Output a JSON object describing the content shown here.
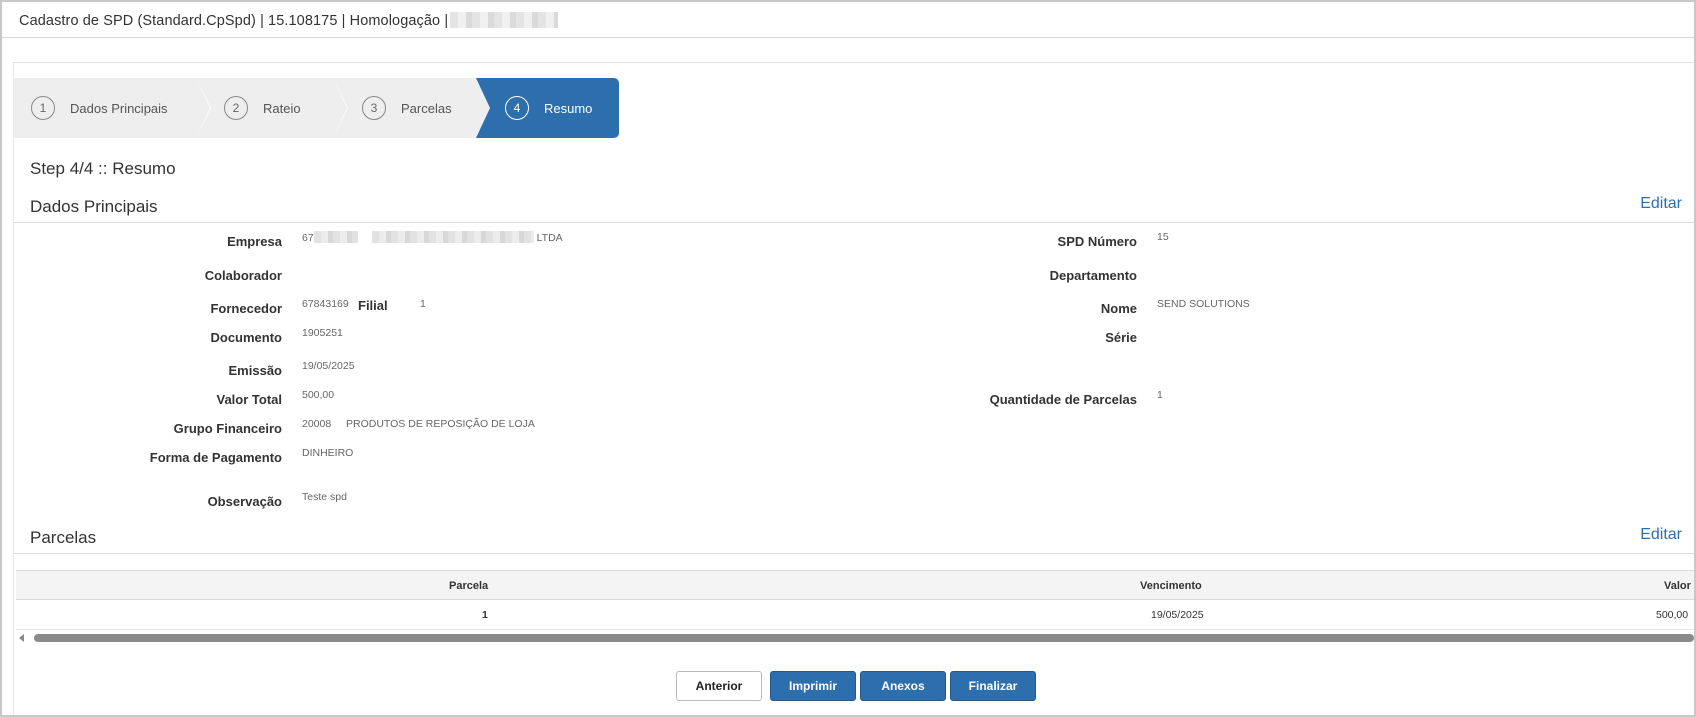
{
  "window": {
    "title": "Cadastro de SPD (Standard.CpSpd) | 15.108175 | Homologação |"
  },
  "wizard": {
    "steps": [
      {
        "num": "1",
        "label": "Dados Principais"
      },
      {
        "num": "2",
        "label": "Rateio"
      },
      {
        "num": "3",
        "label": "Parcelas"
      },
      {
        "num": "4",
        "label": "Resumo"
      }
    ],
    "active_step": 4
  },
  "step_title": "Step 4/4 :: Resumo",
  "dados_principais": {
    "section_title": "Dados Principais",
    "edit_label": "Editar",
    "empresa": {
      "label": "Empresa",
      "value_prefix": "67",
      "value_suffix": "LTDA"
    },
    "spd_numero": {
      "label": "SPD Número",
      "value": "15"
    },
    "colaborador": {
      "label": "Colaborador",
      "value": ""
    },
    "departamento": {
      "label": "Departamento",
      "value": ""
    },
    "fornecedor": {
      "label": "Fornecedor",
      "value": "67843169",
      "filial_label": "Filial",
      "filial_value": "1"
    },
    "nome": {
      "label": "Nome",
      "value": "SEND SOLUTIONS"
    },
    "documento": {
      "label": "Documento",
      "value": "1905251"
    },
    "serie": {
      "label": "Série",
      "value": ""
    },
    "emissao": {
      "label": "Emissão",
      "value": "19/05/2025"
    },
    "valor_total": {
      "label": "Valor Total",
      "value": "500,00"
    },
    "quantidade_parcelas": {
      "label": "Quantidade de Parcelas",
      "value": "1"
    },
    "grupo_financeiro": {
      "label": "Grupo Financeiro",
      "code": "20008",
      "value": "PRODUTOS DE REPOSIÇÃO DE LOJA"
    },
    "forma_pagamento": {
      "label": "Forma de Pagamento",
      "value": "DINHEIRO"
    },
    "observacao": {
      "label": "Observação",
      "value": "Teste spd"
    }
  },
  "parcelas": {
    "section_title": "Parcelas",
    "edit_label": "Editar",
    "columns": [
      "Parcela",
      "Vencimento",
      "Valor"
    ],
    "rows": [
      {
        "parcela": "1",
        "vencimento": "19/05/2025",
        "valor": "500,00"
      }
    ]
  },
  "buttons": {
    "anterior": "Anterior",
    "imprimir": "Imprimir",
    "anexos": "Anexos",
    "finalizar": "Finalizar"
  },
  "colors": {
    "accent": "#2d6fad",
    "step_inactive": "#eeeeee"
  }
}
